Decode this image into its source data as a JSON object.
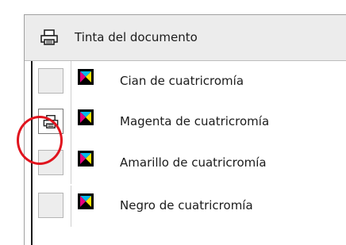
{
  "header": {
    "title": "Tinta del documento",
    "icon": "printer-icon"
  },
  "inks": [
    {
      "label": "Cian de cuatricromía",
      "printing": false,
      "icon": "process-color-icon"
    },
    {
      "label": "Magenta de cuatricromía",
      "printing": true,
      "icon": "process-color-icon"
    },
    {
      "label": "Amarillo de cuatricromía",
      "printing": false,
      "icon": "process-color-icon"
    },
    {
      "label": "Negro de cuatricromía",
      "printing": false,
      "icon": "process-color-icon"
    }
  ],
  "colors": {
    "highlight": "#e0141e",
    "cyan": "#00b7eb",
    "magenta": "#e5007e",
    "yellow": "#ffe500",
    "black": "#000000"
  }
}
